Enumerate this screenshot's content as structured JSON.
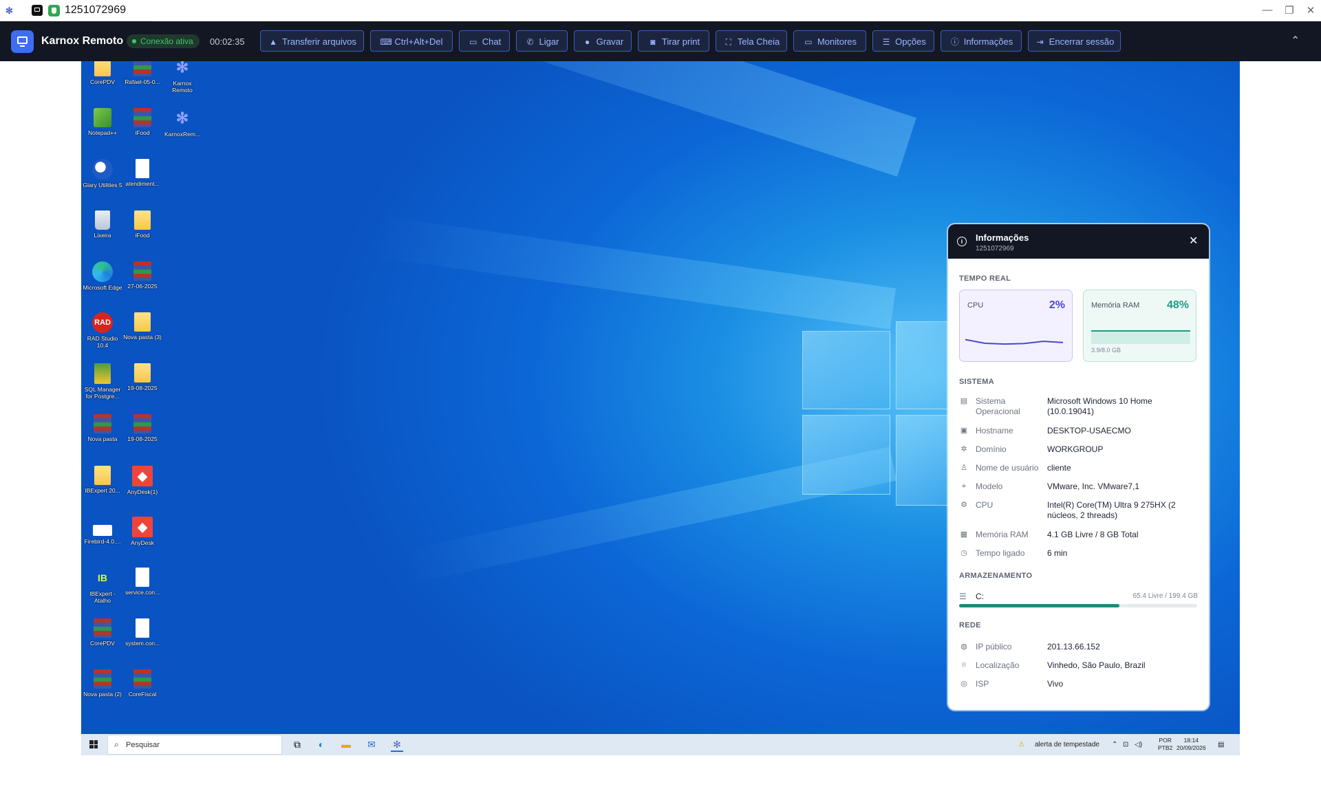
{
  "window": {
    "title": "1251072969",
    "controls": [
      "—",
      "❐",
      "✕"
    ]
  },
  "toolbar": {
    "app_name": "Karnox Remoto",
    "status": "Conexão ativa",
    "timer": "00:02:35",
    "buttons": [
      {
        "label": "Transferir arquivos",
        "icon": "file-upload-icon"
      },
      {
        "label": "Ctrl+Alt+Del",
        "icon": "keyboard-icon"
      },
      {
        "label": "Chat",
        "icon": "chat-icon"
      },
      {
        "label": "Ligar",
        "icon": "phone-icon"
      },
      {
        "label": "Gravar",
        "icon": "record-icon"
      },
      {
        "label": "Tirar print",
        "icon": "camera-icon"
      },
      {
        "label": "Tela Cheia",
        "icon": "fullscreen-icon"
      },
      {
        "label": "Monitores",
        "icon": "monitor-icon"
      },
      {
        "label": "Opções",
        "icon": "sliders-icon"
      },
      {
        "label": "Informações",
        "icon": "info-icon"
      },
      {
        "label": "Encerrar sessão",
        "icon": "logout-icon"
      }
    ]
  },
  "desktop": {
    "icons": [
      {
        "label": "CorePDV",
        "type": "folder"
      },
      {
        "label": "Rafael-05-0...",
        "type": "archive"
      },
      {
        "label": "Karnox Remoto",
        "type": "karnox"
      },
      {
        "label": "Notepad++",
        "type": "notepad"
      },
      {
        "label": "iFood",
        "type": "archive"
      },
      {
        "label": "KarnoxRem...",
        "type": "karnox"
      },
      {
        "label": "Glary Utilities 5",
        "type": "glary"
      },
      {
        "label": "atendiment...",
        "type": "doc"
      },
      {
        "label": "Lixeira",
        "type": "bin"
      },
      {
        "label": "iFood",
        "type": "folder"
      },
      {
        "label": "Microsoft Edge",
        "type": "edge"
      },
      {
        "label": "27-06-2025",
        "type": "archive"
      },
      {
        "label": "RAD Studio 10.4",
        "type": "rad"
      },
      {
        "label": "Nova pasta (3)",
        "type": "folder"
      },
      {
        "label": "SQL Manager for Postgre...",
        "type": "sql"
      },
      {
        "label": "19-08-2025",
        "type": "folder"
      },
      {
        "label": "Nova pasta",
        "type": "archive"
      },
      {
        "label": "19-08-2025",
        "type": "archive"
      },
      {
        "label": "IBExpert 20...",
        "type": "folder"
      },
      {
        "label": "AnyDesk(1)",
        "type": "anydesk"
      },
      {
        "label": "Firebird-4.0....",
        "type": "firebird"
      },
      {
        "label": "AnyDesk",
        "type": "anydesk"
      },
      {
        "label": "IBExpert - Atalho",
        "type": "ibexpert"
      },
      {
        "label": "service.con...",
        "type": "doc"
      },
      {
        "label": "CorePDV",
        "type": "archive"
      },
      {
        "label": "system.con...",
        "type": "doc"
      },
      {
        "label": "Nova pasta (2)",
        "type": "archive"
      },
      {
        "label": "CoreFiscal",
        "type": "archive"
      }
    ]
  },
  "taskbar": {
    "search_placeholder": "Pesquisar",
    "weather": "alerta de tempestade",
    "lang1": "POR",
    "lang2": "PTB2",
    "time": "18:14",
    "date": "20/09/2026"
  },
  "info_panel": {
    "title": "Informações",
    "subtitle": "1251072969",
    "realtime_heading": "TEMPO REAL",
    "cpu": {
      "label": "CPU",
      "value": "2%",
      "series": [
        0.4,
        0.25,
        0.22,
        0.24,
        0.33,
        0.28
      ]
    },
    "ram": {
      "label": "Memória RAM",
      "value": "48%",
      "fraction": 0.48,
      "sub": "3.9/8.0 GB"
    },
    "system_heading": "SISTEMA",
    "system": [
      {
        "key": "Sistema Operacional",
        "value": "Microsoft Windows 10 Home (10.0.19041)",
        "icon": "server-icon"
      },
      {
        "key": "Hostname",
        "value": "DESKTOP-USAECMO",
        "icon": "hostname-icon"
      },
      {
        "key": "Domínio",
        "value": "WORKGROUP",
        "icon": "network-nodes-icon"
      },
      {
        "key": "Nome de usuário",
        "value": "cliente",
        "icon": "user-icon"
      },
      {
        "key": "Modelo",
        "value": "VMware, Inc. VMware7,1",
        "icon": "tag-icon"
      },
      {
        "key": "CPU",
        "value": "Intel(R) Core(TM) Ultra 9 275HX (2 núcleos, 2 threads)",
        "icon": "chip-icon"
      },
      {
        "key": "Memória RAM",
        "value": "4.1 GB Livre / 8 GB Total",
        "icon": "memory-icon"
      },
      {
        "key": "Tempo ligado",
        "value": "6 min",
        "icon": "clock-icon"
      }
    ],
    "storage_heading": "ARMAZENAMENTO",
    "storage": {
      "drive": "C:",
      "text": "65.4 Livre / 199.4 GB",
      "used_fraction": 0.672
    },
    "network_heading": "REDE",
    "network": [
      {
        "key": "IP público",
        "value": "201.13.66.152",
        "icon": "globe-icon"
      },
      {
        "key": "Localização",
        "value": "Vinhedo, São Paulo, Brazil",
        "icon": "pin-icon"
      },
      {
        "key": "ISP",
        "value": "Vivo",
        "icon": "signal-icon"
      }
    ]
  }
}
